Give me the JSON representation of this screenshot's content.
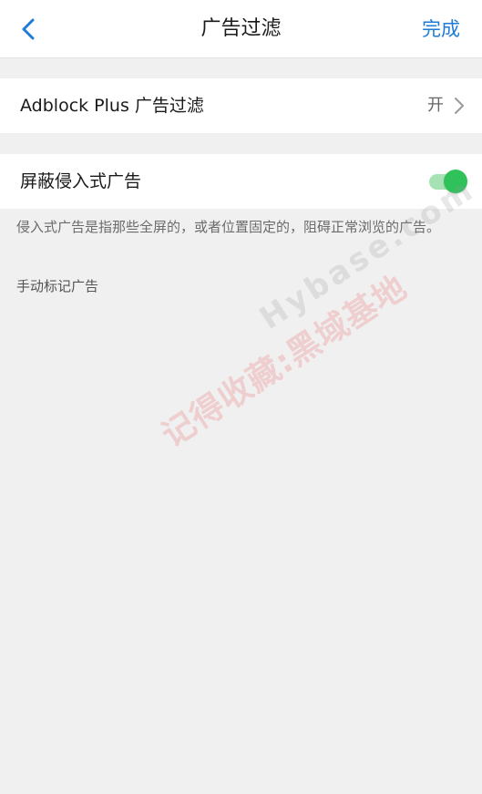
{
  "header": {
    "title": "广告过滤",
    "done_label": "完成",
    "back_icon": "chevron-left-icon",
    "accent_color": "#1f7bd6"
  },
  "settings": {
    "adblock": {
      "label": "Adblock Plus 广告过滤",
      "value": "开",
      "icon": "chevron-right-icon"
    },
    "intrusive": {
      "label": "屏蔽侵入式广告",
      "enabled": true,
      "toggle_color": "#2fc25b"
    }
  },
  "description": "侵入式广告是指那些全屏的，或者位置固定的，阻碍正常浏览的广告。",
  "manual_mark_label": "手动标记广告",
  "watermark": {
    "text_cn": "记得收藏:黑域基地",
    "text_en": "Hybase.com"
  }
}
